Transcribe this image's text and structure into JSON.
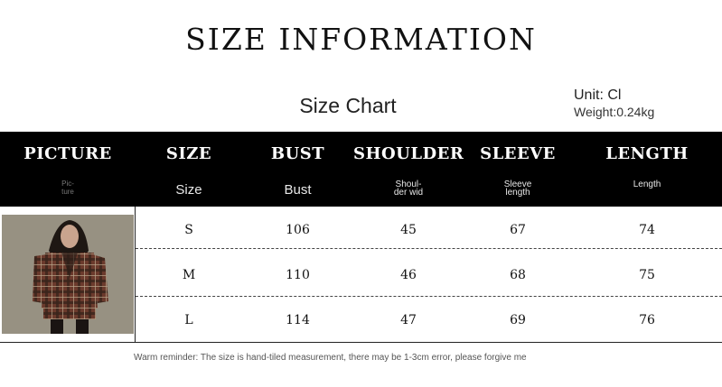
{
  "page_title": "SIZE INFORMATION",
  "chart_title": "Size Chart",
  "unit_label": "Unit: Cl",
  "weight_label": "Weight:0.24kg",
  "columns": [
    {
      "main": "PICTURE",
      "sub": "Pic-\nture"
    },
    {
      "main": "SIZE",
      "sub": "Size"
    },
    {
      "main": "BUST",
      "sub": "Bust"
    },
    {
      "main": "SHOULDER",
      "sub": "Shoul-\nder wid"
    },
    {
      "main": "SLEEVE",
      "sub": "Sleeve\nlength"
    },
    {
      "main": "LENGTH",
      "sub": "Length"
    }
  ],
  "rows": [
    {
      "size": "S",
      "bust": "106",
      "shoulder": "45",
      "sleeve": "67",
      "length": "74"
    },
    {
      "size": "M",
      "bust": "110",
      "shoulder": "46",
      "sleeve": "68",
      "length": "75"
    },
    {
      "size": "L",
      "bust": "114",
      "shoulder": "47",
      "sleeve": "69",
      "length": "76"
    }
  ],
  "reminder": "Warm reminder: The size is hand-tiled measurement, there may be 1-3cm error, please forgive me",
  "photo_icon": "plaid-blazer-photo",
  "colors": {
    "header_bg": "#000000",
    "header_text": "#ffffff",
    "plaid_base": "#6b3a2c"
  }
}
